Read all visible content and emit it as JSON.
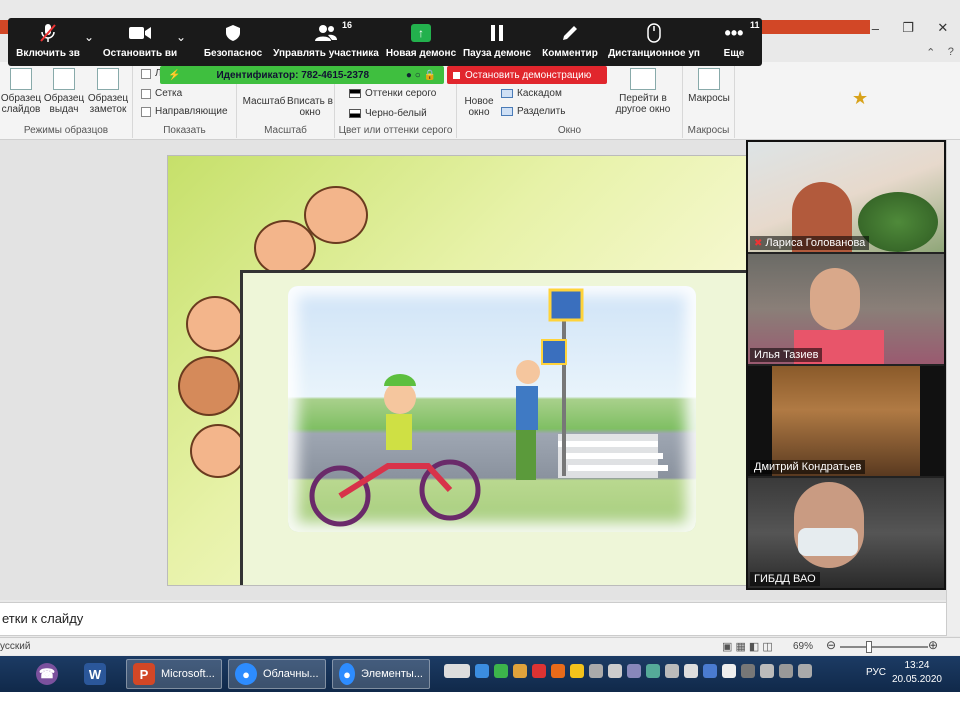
{
  "zoom_toolbar": {
    "items": [
      {
        "label": "Включить зв",
        "icon": "muted-mic-icon"
      },
      {
        "label": "Остановить ви",
        "icon": "video-camera-icon"
      },
      {
        "label": "Безопаснос",
        "icon": "shield-icon"
      },
      {
        "label": "Управлять участника",
        "icon": "participants-icon",
        "badge": "16"
      },
      {
        "label": "Новая демонс",
        "icon": "share-screen-icon"
      },
      {
        "label": "Пауза демонс",
        "icon": "pause-icon"
      },
      {
        "label": "Комментир",
        "icon": "pencil-icon"
      },
      {
        "label": "Дистанционное уп",
        "icon": "mouse-icon"
      },
      {
        "label": "Еще",
        "icon": "more-icon",
        "badge": "11"
      }
    ],
    "meeting_id": "Идентификатор: 782-4615-2378",
    "stop_share": "Остановить демонстрацию"
  },
  "ribbon": {
    "groups": {
      "views": {
        "label": "Режимы образцов",
        "buttons": [
          "Образец слайдов",
          "Образец выдач",
          "Образец заметок"
        ]
      },
      "show": {
        "label": "Показать",
        "items": [
          "Л",
          "Сетка",
          "Направляющие"
        ]
      },
      "zoom": {
        "label": "Масштаб",
        "buttons": [
          "Масштаб",
          "Вписать в окно"
        ]
      },
      "color": {
        "label": "Цвет или оттенки серого",
        "items": [
          "Оттенки серого",
          "Черно-белый"
        ]
      },
      "window": {
        "label": "Окно",
        "new_window": "Новое окно",
        "items": [
          "Каскадом",
          "Разделить"
        ],
        "switch": "Перейти в другое окно"
      },
      "macros": {
        "label": "Макросы",
        "button": "Макросы"
      }
    }
  },
  "participants": [
    {
      "name": "Лариса Голованова",
      "muted": true
    },
    {
      "name": "Илья Тазиев",
      "muted": false
    },
    {
      "name": "Дмитрий Кондратьев",
      "muted": false
    },
    {
      "name": "ГИБДД ВАО",
      "muted": false
    }
  ],
  "notes": {
    "text": "етки к слайду"
  },
  "status": {
    "language": "усский",
    "zoom": "69%"
  },
  "taskbar": {
    "apps": [
      {
        "label": "",
        "icon": "viber-icon",
        "color": "#7b519d"
      },
      {
        "label": "",
        "icon": "word-icon",
        "color": "#2b579a"
      },
      {
        "label": "Microsoft...",
        "icon": "powerpoint-icon",
        "color": "#d24726"
      },
      {
        "label": "Облачны...",
        "icon": "zoom-icon",
        "color": "#2d8cff"
      },
      {
        "label": "Элементы...",
        "icon": "zoom-icon",
        "color": "#2d8cff"
      }
    ],
    "lang": "РУС",
    "time": "13:24",
    "date": "20.05.2020"
  }
}
